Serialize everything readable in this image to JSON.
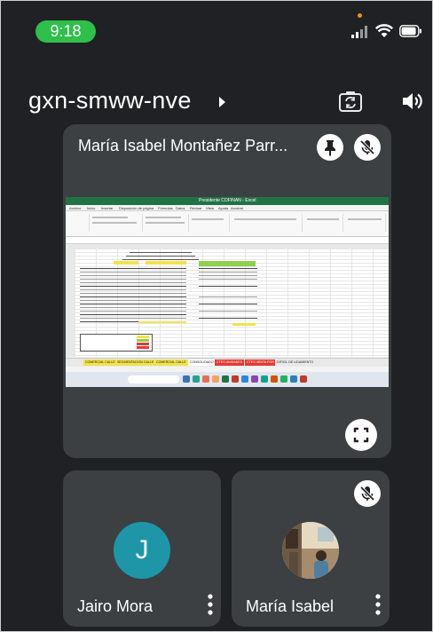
{
  "status_bar": {
    "time": "9:18"
  },
  "meeting": {
    "code": "gxn-smww-nve"
  },
  "main_tile": {
    "presenter_name": "María Isabel Montañez Parr..."
  },
  "screen_share": {
    "app_title": "Presidente COFINAN - Excel",
    "ribbon_tabs": [
      "Archivo",
      "Inicio",
      "Insertar",
      "Disposición de página",
      "Fórmulas",
      "Datos",
      "Revisar",
      "Vista",
      "Ayuda",
      "Acrobat"
    ],
    "sheet_tabs": [
      "COMERCIAL CALLE",
      "SEGMENTACION CALLE",
      "COMERCIAL CALLE",
      "CONSOLIDADO",
      "CTES UNIDADES",
      "CTES VENTA POR",
      "DIFICIL DE LIDAMIENTO"
    ],
    "taskbar_search": "Buscar"
  },
  "participants": [
    {
      "name": "Jairo Mora",
      "initial": "J",
      "avatar_color": "#1e96a8"
    },
    {
      "name": "María Isabel",
      "muted": true
    }
  ],
  "colors": {
    "background": "#202124",
    "tile": "#3c4043",
    "time_pill": "#2fbf4b",
    "excel_green": "#217346"
  },
  "icons": [
    "signal-icon",
    "wifi-icon",
    "battery-icon",
    "chevron-right-icon",
    "switch-camera-icon",
    "speaker-icon",
    "pin-icon",
    "mic-off-icon",
    "fullscreen-icon",
    "more-vert-icon"
  ]
}
